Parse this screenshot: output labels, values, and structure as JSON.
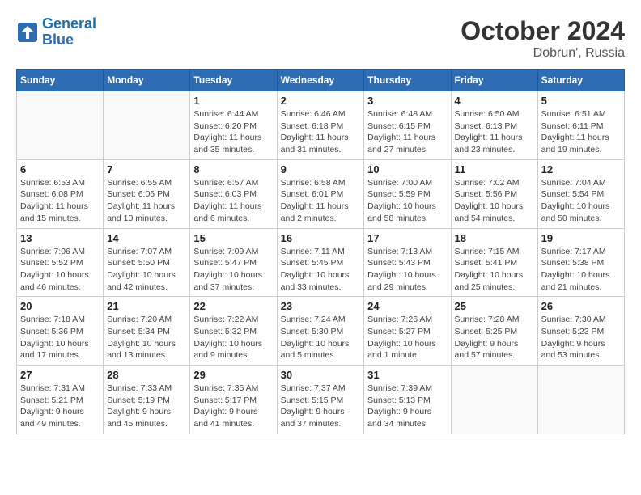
{
  "header": {
    "logo_line1": "General",
    "logo_line2": "Blue",
    "month": "October 2024",
    "location": "Dobrun', Russia"
  },
  "weekdays": [
    "Sunday",
    "Monday",
    "Tuesday",
    "Wednesday",
    "Thursday",
    "Friday",
    "Saturday"
  ],
  "weeks": [
    [
      {
        "day": "",
        "sunrise": "",
        "sunset": "",
        "daylight": ""
      },
      {
        "day": "",
        "sunrise": "",
        "sunset": "",
        "daylight": ""
      },
      {
        "day": "1",
        "sunrise": "Sunrise: 6:44 AM",
        "sunset": "Sunset: 6:20 PM",
        "daylight": "Daylight: 11 hours and 35 minutes."
      },
      {
        "day": "2",
        "sunrise": "Sunrise: 6:46 AM",
        "sunset": "Sunset: 6:18 PM",
        "daylight": "Daylight: 11 hours and 31 minutes."
      },
      {
        "day": "3",
        "sunrise": "Sunrise: 6:48 AM",
        "sunset": "Sunset: 6:15 PM",
        "daylight": "Daylight: 11 hours and 27 minutes."
      },
      {
        "day": "4",
        "sunrise": "Sunrise: 6:50 AM",
        "sunset": "Sunset: 6:13 PM",
        "daylight": "Daylight: 11 hours and 23 minutes."
      },
      {
        "day": "5",
        "sunrise": "Sunrise: 6:51 AM",
        "sunset": "Sunset: 6:11 PM",
        "daylight": "Daylight: 11 hours and 19 minutes."
      }
    ],
    [
      {
        "day": "6",
        "sunrise": "Sunrise: 6:53 AM",
        "sunset": "Sunset: 6:08 PM",
        "daylight": "Daylight: 11 hours and 15 minutes."
      },
      {
        "day": "7",
        "sunrise": "Sunrise: 6:55 AM",
        "sunset": "Sunset: 6:06 PM",
        "daylight": "Daylight: 11 hours and 10 minutes."
      },
      {
        "day": "8",
        "sunrise": "Sunrise: 6:57 AM",
        "sunset": "Sunset: 6:03 PM",
        "daylight": "Daylight: 11 hours and 6 minutes."
      },
      {
        "day": "9",
        "sunrise": "Sunrise: 6:58 AM",
        "sunset": "Sunset: 6:01 PM",
        "daylight": "Daylight: 11 hours and 2 minutes."
      },
      {
        "day": "10",
        "sunrise": "Sunrise: 7:00 AM",
        "sunset": "Sunset: 5:59 PM",
        "daylight": "Daylight: 10 hours and 58 minutes."
      },
      {
        "day": "11",
        "sunrise": "Sunrise: 7:02 AM",
        "sunset": "Sunset: 5:56 PM",
        "daylight": "Daylight: 10 hours and 54 minutes."
      },
      {
        "day": "12",
        "sunrise": "Sunrise: 7:04 AM",
        "sunset": "Sunset: 5:54 PM",
        "daylight": "Daylight: 10 hours and 50 minutes."
      }
    ],
    [
      {
        "day": "13",
        "sunrise": "Sunrise: 7:06 AM",
        "sunset": "Sunset: 5:52 PM",
        "daylight": "Daylight: 10 hours and 46 minutes."
      },
      {
        "day": "14",
        "sunrise": "Sunrise: 7:07 AM",
        "sunset": "Sunset: 5:50 PM",
        "daylight": "Daylight: 10 hours and 42 minutes."
      },
      {
        "day": "15",
        "sunrise": "Sunrise: 7:09 AM",
        "sunset": "Sunset: 5:47 PM",
        "daylight": "Daylight: 10 hours and 37 minutes."
      },
      {
        "day": "16",
        "sunrise": "Sunrise: 7:11 AM",
        "sunset": "Sunset: 5:45 PM",
        "daylight": "Daylight: 10 hours and 33 minutes."
      },
      {
        "day": "17",
        "sunrise": "Sunrise: 7:13 AM",
        "sunset": "Sunset: 5:43 PM",
        "daylight": "Daylight: 10 hours and 29 minutes."
      },
      {
        "day": "18",
        "sunrise": "Sunrise: 7:15 AM",
        "sunset": "Sunset: 5:41 PM",
        "daylight": "Daylight: 10 hours and 25 minutes."
      },
      {
        "day": "19",
        "sunrise": "Sunrise: 7:17 AM",
        "sunset": "Sunset: 5:38 PM",
        "daylight": "Daylight: 10 hours and 21 minutes."
      }
    ],
    [
      {
        "day": "20",
        "sunrise": "Sunrise: 7:18 AM",
        "sunset": "Sunset: 5:36 PM",
        "daylight": "Daylight: 10 hours and 17 minutes."
      },
      {
        "day": "21",
        "sunrise": "Sunrise: 7:20 AM",
        "sunset": "Sunset: 5:34 PM",
        "daylight": "Daylight: 10 hours and 13 minutes."
      },
      {
        "day": "22",
        "sunrise": "Sunrise: 7:22 AM",
        "sunset": "Sunset: 5:32 PM",
        "daylight": "Daylight: 10 hours and 9 minutes."
      },
      {
        "day": "23",
        "sunrise": "Sunrise: 7:24 AM",
        "sunset": "Sunset: 5:30 PM",
        "daylight": "Daylight: 10 hours and 5 minutes."
      },
      {
        "day": "24",
        "sunrise": "Sunrise: 7:26 AM",
        "sunset": "Sunset: 5:27 PM",
        "daylight": "Daylight: 10 hours and 1 minute."
      },
      {
        "day": "25",
        "sunrise": "Sunrise: 7:28 AM",
        "sunset": "Sunset: 5:25 PM",
        "daylight": "Daylight: 9 hours and 57 minutes."
      },
      {
        "day": "26",
        "sunrise": "Sunrise: 7:30 AM",
        "sunset": "Sunset: 5:23 PM",
        "daylight": "Daylight: 9 hours and 53 minutes."
      }
    ],
    [
      {
        "day": "27",
        "sunrise": "Sunrise: 7:31 AM",
        "sunset": "Sunset: 5:21 PM",
        "daylight": "Daylight: 9 hours and 49 minutes."
      },
      {
        "day": "28",
        "sunrise": "Sunrise: 7:33 AM",
        "sunset": "Sunset: 5:19 PM",
        "daylight": "Daylight: 9 hours and 45 minutes."
      },
      {
        "day": "29",
        "sunrise": "Sunrise: 7:35 AM",
        "sunset": "Sunset: 5:17 PM",
        "daylight": "Daylight: 9 hours and 41 minutes."
      },
      {
        "day": "30",
        "sunrise": "Sunrise: 7:37 AM",
        "sunset": "Sunset: 5:15 PM",
        "daylight": "Daylight: 9 hours and 37 minutes."
      },
      {
        "day": "31",
        "sunrise": "Sunrise: 7:39 AM",
        "sunset": "Sunset: 5:13 PM",
        "daylight": "Daylight: 9 hours and 34 minutes."
      },
      {
        "day": "",
        "sunrise": "",
        "sunset": "",
        "daylight": ""
      },
      {
        "day": "",
        "sunrise": "",
        "sunset": "",
        "daylight": ""
      }
    ]
  ]
}
